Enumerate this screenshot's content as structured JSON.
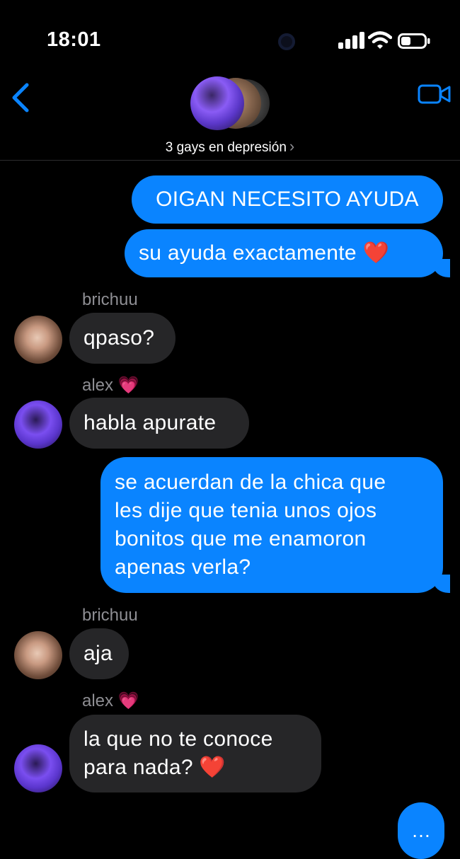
{
  "status_bar": {
    "time": "18:01"
  },
  "header": {
    "group_name": "3 gays en depresión",
    "chevron": "›",
    "icons": {
      "back": "chevron-left-icon",
      "video": "video-camera-icon"
    }
  },
  "messages": [
    {
      "type": "outgoing",
      "text": "OIGAN NECESITO AYUDA"
    },
    {
      "type": "outgoing",
      "text": "su ayuda exactamente ❤️"
    },
    {
      "type": "incoming",
      "sender": "brichuu",
      "text": "qpaso?"
    },
    {
      "type": "incoming",
      "sender": "alex 💗",
      "text": "habla apurate"
    },
    {
      "type": "outgoing",
      "lines": [
        "se acuerdan de la chica que",
        "les dije que tenia unos ojos",
        "bonitos que me enamoron",
        "apenas verla?"
      ]
    },
    {
      "type": "incoming",
      "sender": "brichuu",
      "text": "aja"
    },
    {
      "type": "incoming",
      "sender": "alex 💗",
      "lines": [
        "la que no te conoce",
        "para nada? ❤️"
      ]
    }
  ],
  "typing_indicator": "…",
  "colors": {
    "outgoing_bubble": "#0a84ff",
    "incoming_bubble": "#262628",
    "background": "#000000"
  }
}
